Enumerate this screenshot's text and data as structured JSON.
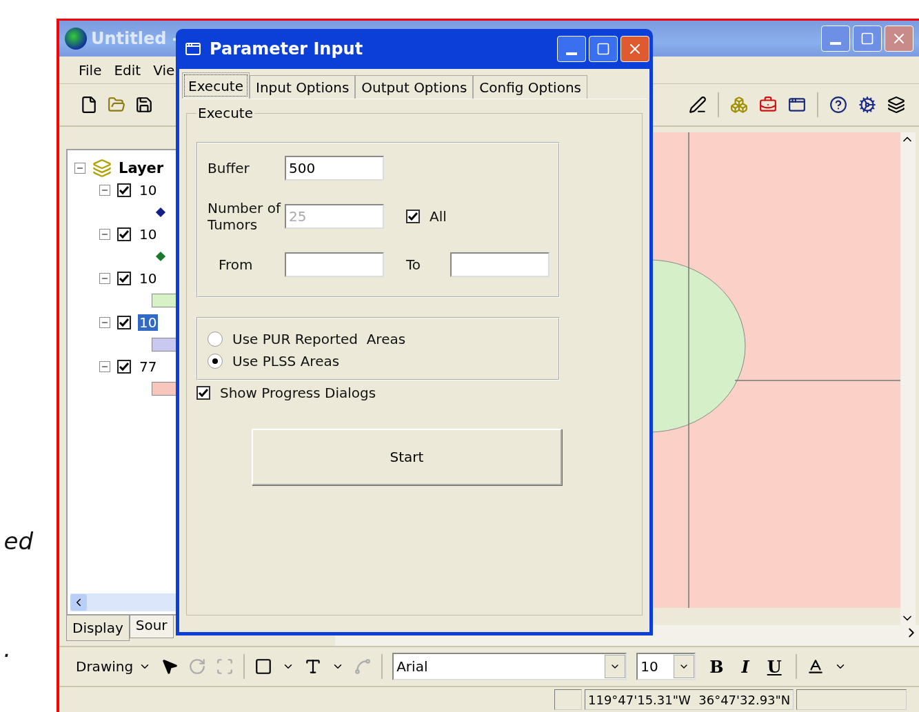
{
  "slide_fragments": [
    "ed",
    "."
  ],
  "window": {
    "title": "Untitled -"
  },
  "menu": [
    "File",
    "Edit",
    "Vie"
  ],
  "toc": {
    "root": "Layer",
    "layers": [
      {
        "label": "10",
        "checked": true,
        "selected": false,
        "kind": "point",
        "color": "#14208a"
      },
      {
        "label": "10",
        "checked": true,
        "selected": false,
        "kind": "point",
        "color": "#1b7a2a"
      },
      {
        "label": "10",
        "checked": true,
        "selected": false,
        "kind": "fill",
        "color": "#d6f2c6"
      },
      {
        "label": "10",
        "checked": true,
        "selected": true,
        "kind": "fill",
        "color": "#c8c8f0"
      },
      {
        "label": "77",
        "checked": true,
        "selected": false,
        "kind": "fill",
        "color": "#f8c6bc"
      }
    ],
    "tabs": [
      {
        "label": "Display",
        "selected": true
      },
      {
        "label": "Sour",
        "selected": false
      }
    ]
  },
  "dialog": {
    "title": "Parameter Input",
    "tabs": [
      {
        "label": "Execute",
        "selected": true
      },
      {
        "label": "Input Options",
        "selected": false
      },
      {
        "label": "Output Options",
        "selected": false
      },
      {
        "label": "Config Options",
        "selected": false
      }
    ],
    "group": "Execute",
    "buffer": {
      "label": "Buffer",
      "value": "500"
    },
    "tumors": {
      "label": "Number of Tumors",
      "value": "25",
      "disabled": true
    },
    "all": {
      "label": "All",
      "checked": true
    },
    "from": {
      "label": "From"
    },
    "to": {
      "label": "To"
    },
    "areas": [
      {
        "label": "Use PUR Reported  Areas",
        "selected": false
      },
      {
        "label": "Use PLSS Areas",
        "selected": true
      }
    ],
    "progress": {
      "label": "Show Progress Dialogs",
      "checked": true
    },
    "start": "Start"
  },
  "drawing_toolbar": {
    "menu": "Drawing",
    "font": "Arial",
    "size": "10",
    "bold": "B",
    "italic": "I",
    "underline": "U"
  },
  "status_bar": {
    "coordinates": "119°47'15.31\"W  36°47'32.93\"N"
  }
}
